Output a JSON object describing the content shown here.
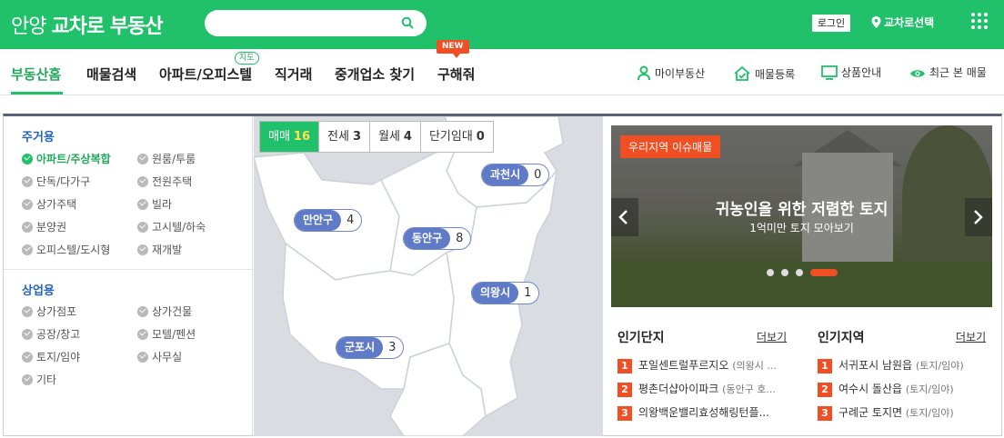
{
  "header": {
    "logo_region": "안양",
    "logo_brand": "교차로 부동산",
    "search_placeholder": "",
    "login_label": "로그인",
    "region_select_label": "교차로선택",
    "colors": {
      "brand": "#21c06a",
      "accent": "#f04e23"
    }
  },
  "nav": {
    "tabs": [
      {
        "label": "부동산홈",
        "active": true
      },
      {
        "label": "매물검색"
      },
      {
        "label": "아파트/오피스텔",
        "badge": "지도"
      },
      {
        "label": "직거래"
      },
      {
        "label": "중개업소 찾기"
      },
      {
        "label": "구해줘",
        "badge": "NEW"
      }
    ],
    "utilities": [
      {
        "label": "마이부동산",
        "icon": "person-icon"
      },
      {
        "label": "매물등록",
        "icon": "house-check-icon"
      },
      {
        "label": "상품안내",
        "icon": "monitor-icon"
      },
      {
        "label": "최근 본 매물",
        "icon": "eye-icon"
      }
    ]
  },
  "categories": {
    "residential_title": "주거용",
    "residential": [
      {
        "label": "아파트/주상복합",
        "selected": true
      },
      {
        "label": "원룸/투룸"
      },
      {
        "label": "단독/다가구"
      },
      {
        "label": "전원주택"
      },
      {
        "label": "상가주택"
      },
      {
        "label": "빌라"
      },
      {
        "label": "분양권"
      },
      {
        "label": "고시텔/하숙"
      },
      {
        "label": "오피스텔/도시형"
      },
      {
        "label": "재개발"
      }
    ],
    "commercial_title": "상업용",
    "commercial": [
      {
        "label": "상가점포"
      },
      {
        "label": "상가건물"
      },
      {
        "label": "공장/창고"
      },
      {
        "label": "모텔/펜션"
      },
      {
        "label": "토지/임야"
      },
      {
        "label": "사무실"
      },
      {
        "label": "기타"
      }
    ]
  },
  "map": {
    "deal_tabs": [
      {
        "label": "매매",
        "count": "16",
        "active": true
      },
      {
        "label": "전세",
        "count": "3"
      },
      {
        "label": "월세",
        "count": "4"
      },
      {
        "label": "단기임대",
        "count": "0"
      }
    ],
    "regions": [
      {
        "name": "과천시",
        "count": "0"
      },
      {
        "name": "만안구",
        "count": "4"
      },
      {
        "name": "동안구",
        "count": "8"
      },
      {
        "name": "의왕시",
        "count": "1"
      },
      {
        "name": "군포시",
        "count": "3"
      }
    ]
  },
  "banner": {
    "tag": "우리지역 이슈매물",
    "title": "귀농인을 위한 저렴한 토지",
    "subtitle": "1억미만 토지 모아보기",
    "slides": 4,
    "active_slide": 4
  },
  "popular_complex": {
    "title": "인기단지",
    "more": "더보기",
    "items": [
      {
        "rank": "1",
        "name": "포일센트럴푸르지오",
        "sub": "(의왕시 ..."
      },
      {
        "rank": "2",
        "name": "평촌더샵아이파크",
        "sub": "(동안구 호..."
      },
      {
        "rank": "3",
        "name": "의왕백운밸리효성해링턴플...",
        "sub": ""
      }
    ]
  },
  "popular_region": {
    "title": "인기지역",
    "more": "더보기",
    "items": [
      {
        "rank": "1",
        "name": "서귀포시 남원읍",
        "sub": "(토지/임야)"
      },
      {
        "rank": "2",
        "name": "여수시 돌산읍",
        "sub": "(토지/임야)"
      },
      {
        "rank": "3",
        "name": "구례군 토지면",
        "sub": "(토지/임야)"
      }
    ]
  }
}
